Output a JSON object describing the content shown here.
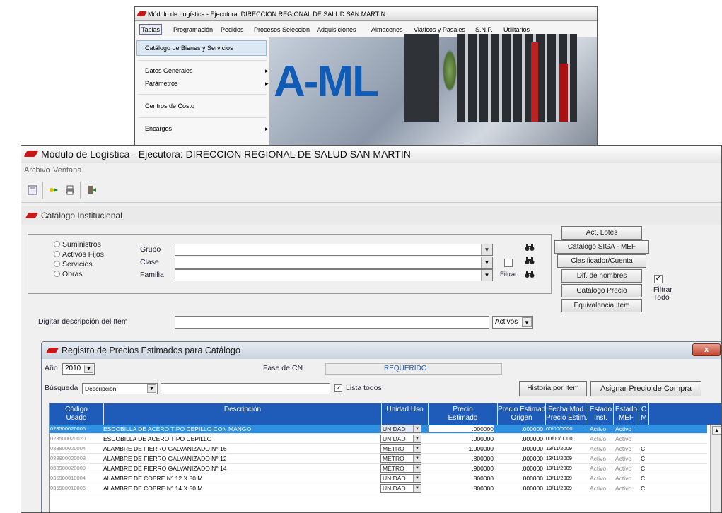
{
  "back_window": {
    "title": "Módulo de Logística - Ejecutora: DIRECCION REGIONAL DE SALUD SAN MARTIN",
    "menu": [
      "Tablas",
      "Programación",
      "Pedidos",
      "Procesos Seleccion",
      "Adquisiciones",
      "Almacenes",
      "Viáticos y Pasajes",
      "S.N.P.",
      "Utilitarios"
    ],
    "dropdown_items": [
      "Catálogo de Bienes y Servicios",
      "Datos Generales",
      "Parámetros",
      "Centros de Costo",
      "Encargos"
    ],
    "splash_text": "A-ML"
  },
  "main_window": {
    "title": "Módulo de Logística - Ejecutora: DIRECCION REGIONAL DE SALUD SAN MARTIN",
    "menu": [
      "Archivo",
      "Ventana"
    ],
    "toolbar_icons": [
      "save-icon",
      "forward-icon",
      "print-icon",
      "exit-icon"
    ]
  },
  "catalog": {
    "header": "Catálogo Institucional",
    "types": [
      "Suministros",
      "Activos Fijos",
      "Servicios",
      "Obras"
    ],
    "labels": {
      "grupo": "Grupo",
      "clase": "Clase",
      "familia": "Familia",
      "filtrar": "Filtrar",
      "digitar": "Digitar descripción del Item",
      "filtrar_todo": "Filtrar\nTodo"
    },
    "activos_value": "Activos",
    "buttons": [
      "Act. Lotes",
      "Catalogo SIGA - MEF",
      "Clasificador/Cuenta",
      "Dif. de nombres",
      "Catálogo Precio",
      "Equivalencia Item"
    ]
  },
  "dialog": {
    "title": "Registro de Precios Estimados para Catálogo",
    "close_label": "x",
    "anio_label": "Año",
    "anio_value": "2010",
    "fase_label": "Fase de CN",
    "fase_value": "REQUERIDO",
    "busqueda_label": "Búsqueda",
    "busqueda_value": "Descripción",
    "lista_todos": "Lista todos",
    "btn_historia": "Historia por Item",
    "btn_asignar": "Asignar Precio de Compra"
  },
  "grid": {
    "columns": [
      "Código\nUsado",
      "Descripción",
      "Unidad Uso",
      "Precio\nEstimado",
      "Precio Estimado\nOrigen",
      "Fecha Mod.\nPrecio Estim.",
      "Estado\nInst.",
      "Estado\nMEF",
      "C\nM"
    ],
    "rows": [
      {
        "codigo": "023500020006",
        "descripcion": "ESCOBILLA DE ACERO TIPO CEPILLO CON MANGO",
        "unidad": "UNIDAD",
        "precio": ".000000",
        "origen": ".000000",
        "fecha": "00/00/0000",
        "est_inst": "Activo",
        "est_mef": "Activo",
        "c": ""
      },
      {
        "codigo": "023500020020",
        "descripcion": "ESCOBILLA DE ACERO TIPO CEPILLO",
        "unidad": "UNIDAD",
        "precio": ".000000",
        "origen": ".000000",
        "fecha": "00/00/0000",
        "est_inst": "Activo",
        "est_mef": "Activo",
        "c": ""
      },
      {
        "codigo": "033900020004",
        "descripcion": "ALAMBRE DE FIERRO GALVANIZADO N° 16",
        "unidad": "METRO",
        "precio": "1.000000",
        "origen": ".000000",
        "fecha": "13/11/2009",
        "est_inst": "Activo",
        "est_mef": "Activo",
        "c": "C"
      },
      {
        "codigo": "033900020008",
        "descripcion": "ALAMBRE DE FIERRO GALVANIZADO N° 12",
        "unidad": "METRO",
        "precio": ".800000",
        "origen": ".000000",
        "fecha": "13/11/2009",
        "est_inst": "Activo",
        "est_mef": "Activo",
        "c": "C"
      },
      {
        "codigo": "033900020009",
        "descripcion": "ALAMBRE DE FIERRO GALVANIZADO N° 14",
        "unidad": "METRO",
        "precio": ".900000",
        "origen": ".000000",
        "fecha": "13/11/2009",
        "est_inst": "Activo",
        "est_mef": "Activo",
        "c": "C"
      },
      {
        "codigo": "035900010004",
        "descripcion": "ALAMBRE DE COBRE N° 12 X 50 M",
        "unidad": "UNIDAD",
        "precio": ".800000",
        "origen": ".000000",
        "fecha": "13/11/2009",
        "est_inst": "Activo",
        "est_mef": "Activo",
        "c": "C"
      },
      {
        "codigo": "035900010006",
        "descripcion": "ALAMBRE DE COBRE N° 14 X 50 M",
        "unidad": "UNIDAD",
        "precio": ".800000",
        "origen": ".000000",
        "fecha": "13/11/2009",
        "est_inst": "Activo",
        "est_mef": "Activo",
        "c": "C"
      }
    ]
  },
  "colors": {
    "accent": "#1f5bb8",
    "selection": "#2f8fe0",
    "brand": "#c81818"
  }
}
